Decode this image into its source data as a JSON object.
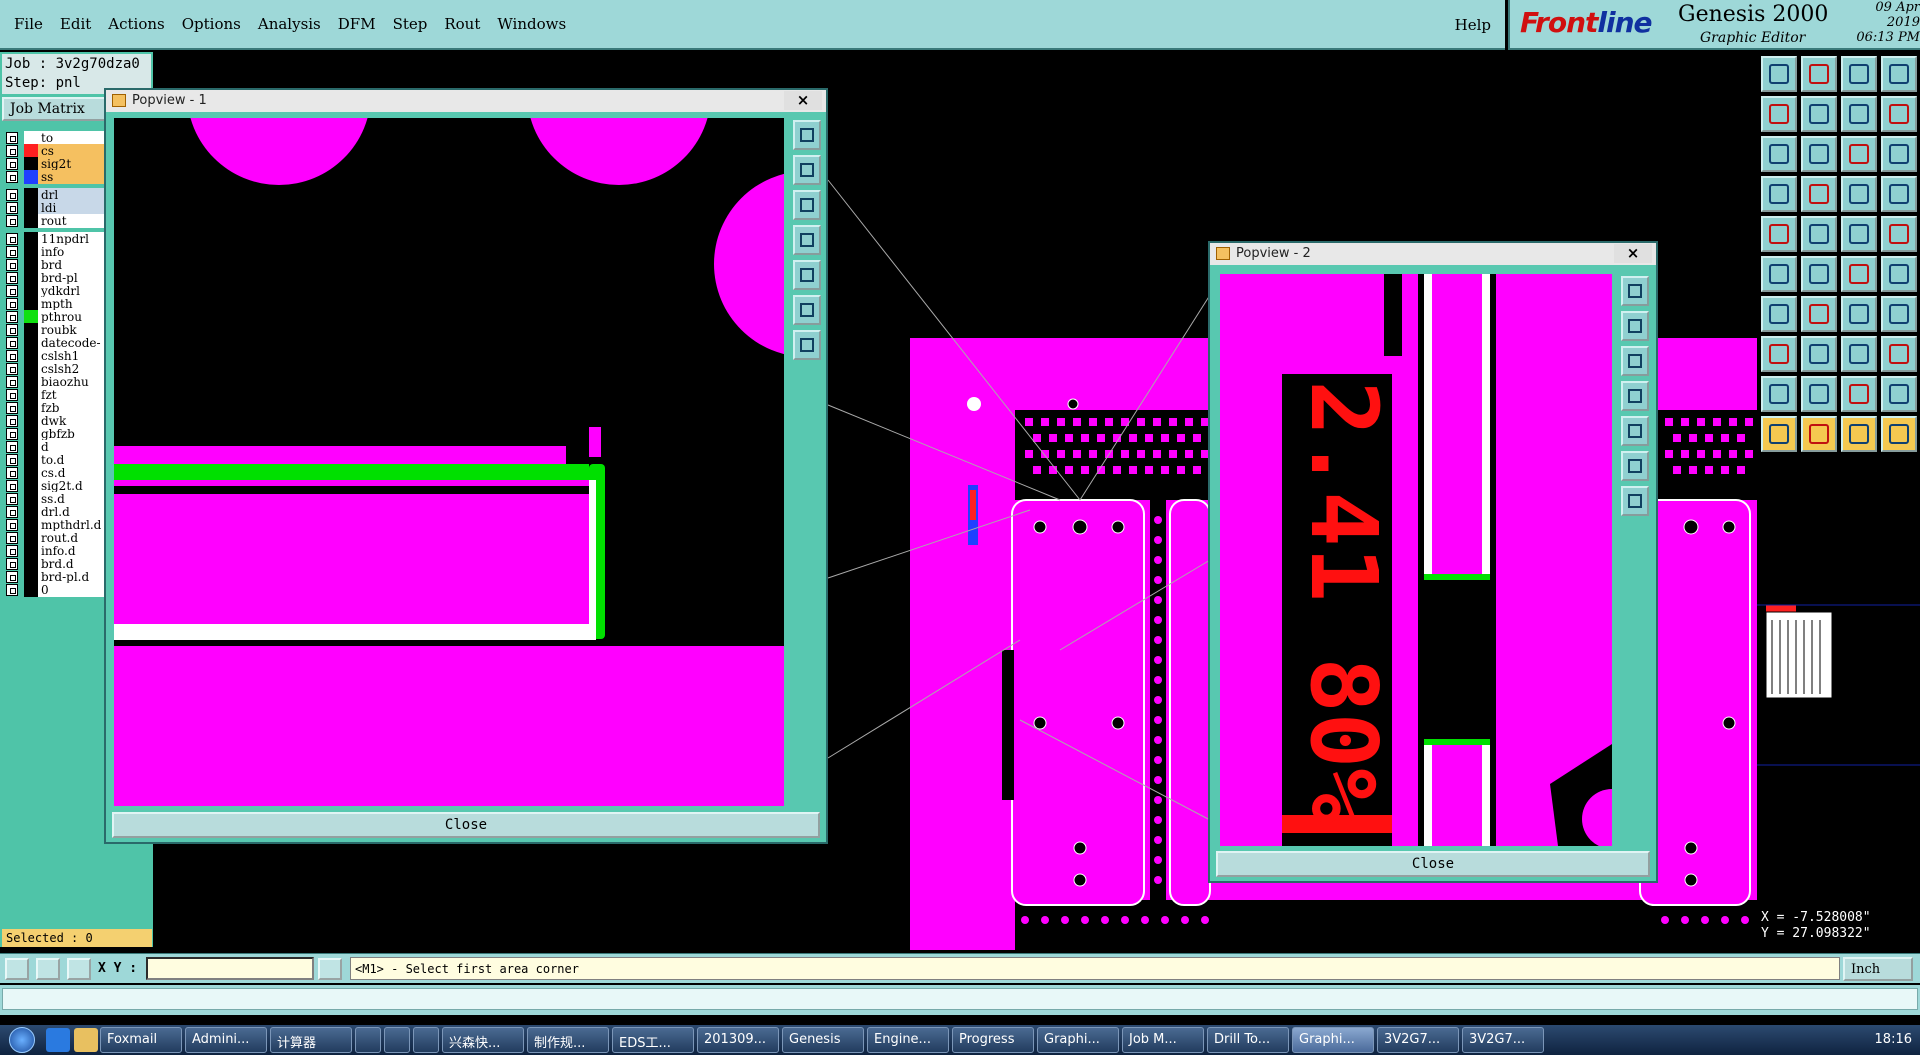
{
  "menubar": {
    "items": [
      "File",
      "Edit",
      "Actions",
      "Options",
      "Analysis",
      "DFM",
      "Step",
      "Rout",
      "Windows"
    ],
    "help": "Help"
  },
  "brand": {
    "logo_a": "Front",
    "logo_b": "line",
    "product": "Genesis 2000",
    "subtitle": "Graphic Editor",
    "date": "09 Apr 2019",
    "time": "06:13 PM"
  },
  "job": {
    "job_line": "Job : 3v2g70dza0",
    "step_line": "Step: pnl",
    "matrix_button": "Job Matrix"
  },
  "layers": [
    {
      "name": "to",
      "color": "#ffffff",
      "hl": "#ffffff"
    },
    {
      "name": "cs",
      "color": "#ff2020",
      "hl": "#f5c060"
    },
    {
      "name": "sig2t",
      "color": "#000000",
      "hl": "#f5c060"
    },
    {
      "name": "ss",
      "color": "#2040ff",
      "hl": "#f5c060"
    },
    {
      "name": "drl",
      "color": "#000000",
      "hl": "#c8d8e8"
    },
    {
      "name": "ldi",
      "color": "#000000",
      "hl": "#c8d8e8"
    },
    {
      "name": "rout",
      "color": "#000000",
      "hl": "#ffffff"
    },
    {
      "name": "11npdrl",
      "color": "#000000",
      "hl": "#ffffff"
    },
    {
      "name": "info",
      "color": "#000000",
      "hl": "#ffffff"
    },
    {
      "name": "brd",
      "color": "#000000",
      "hl": "#ffffff"
    },
    {
      "name": "brd-pl",
      "color": "#000000",
      "hl": "#ffffff"
    },
    {
      "name": "ydkdrl",
      "color": "#000000",
      "hl": "#ffffff"
    },
    {
      "name": "mpth",
      "color": "#000000",
      "hl": "#ffffff"
    },
    {
      "name": "pthrou",
      "color": "#10e010",
      "hl": "#ffffff"
    },
    {
      "name": "roubk",
      "color": "#000000",
      "hl": "#ffffff"
    },
    {
      "name": "datecode-",
      "color": "#000000",
      "hl": "#ffffff"
    },
    {
      "name": "cslsh1",
      "color": "#000000",
      "hl": "#ffffff"
    },
    {
      "name": "cslsh2",
      "color": "#000000",
      "hl": "#ffffff"
    },
    {
      "name": "biaozhu",
      "color": "#000000",
      "hl": "#ffffff"
    },
    {
      "name": "fzt",
      "color": "#000000",
      "hl": "#ffffff"
    },
    {
      "name": "fzb",
      "color": "#000000",
      "hl": "#ffffff"
    },
    {
      "name": "dwk",
      "color": "#000000",
      "hl": "#ffffff"
    },
    {
      "name": "gbfzb",
      "color": "#000000",
      "hl": "#ffffff"
    },
    {
      "name": "d",
      "color": "#000000",
      "hl": "#ffffff"
    },
    {
      "name": "to.d",
      "color": "#000000",
      "hl": "#ffffff"
    },
    {
      "name": "cs.d",
      "color": "#000000",
      "hl": "#ffffff"
    },
    {
      "name": "sig2t.d",
      "color": "#000000",
      "hl": "#ffffff"
    },
    {
      "name": "ss.d",
      "color": "#000000",
      "hl": "#ffffff"
    },
    {
      "name": "drl.d",
      "color": "#000000",
      "hl": "#ffffff"
    },
    {
      "name": "mpthdrl.d",
      "color": "#000000",
      "hl": "#ffffff"
    },
    {
      "name": "rout.d",
      "color": "#000000",
      "hl": "#ffffff"
    },
    {
      "name": "info.d",
      "color": "#000000",
      "hl": "#ffffff"
    },
    {
      "name": "brd.d",
      "color": "#000000",
      "hl": "#ffffff"
    },
    {
      "name": "brd-pl.d",
      "color": "#000000",
      "hl": "#ffffff"
    },
    {
      "name": "0",
      "color": "#000000",
      "hl": "#ffffff"
    }
  ],
  "selected": "Selected : 0",
  "popview1": {
    "title": "Popview - 1",
    "close": "Close",
    "x": "×"
  },
  "popview2": {
    "title": "Popview - 2",
    "close": "Close",
    "x": "×",
    "board_text": "2.41 80%"
  },
  "coords": {
    "x": "X = -7.528008\"",
    "y": "Y = 27.098322\""
  },
  "bottom": {
    "xy_label": "X Y :",
    "xy_value": "",
    "prompt": "<M1> - Select first area corner",
    "units": "Inch"
  },
  "taskbar": {
    "tasks": [
      "Foxmail",
      "Admini...",
      "计算器",
      "",
      "",
      "",
      "兴森快...",
      "制作规...",
      "EDS工...",
      "201309...",
      "Genesis",
      "Engine...",
      "Progress",
      "Graphi...",
      "Job M...",
      "Drill To...",
      "Graphi...",
      "3V2G7...",
      "3V2G7..."
    ],
    "active_index": 16,
    "clock": "18:16"
  },
  "colors": {
    "magenta": "#ff00ff",
    "green": "#00e000",
    "red": "#ff1010",
    "panel": "#9ed8d8",
    "teal": "#4fc4a8"
  }
}
